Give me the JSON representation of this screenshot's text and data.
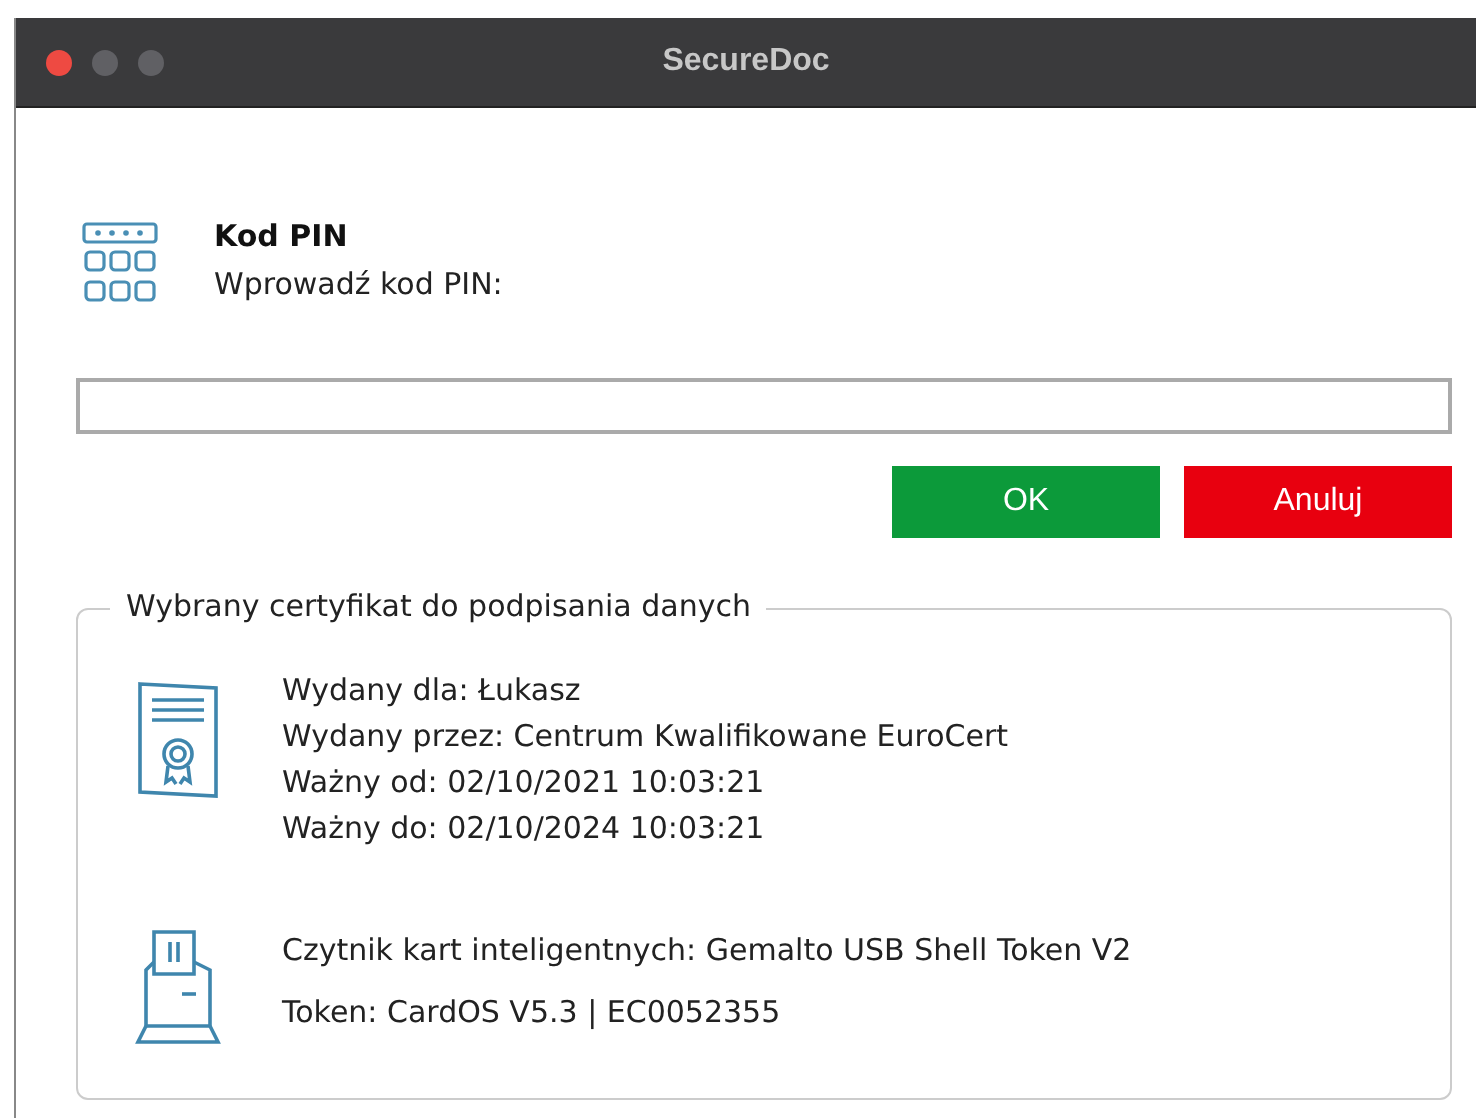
{
  "window": {
    "title": "SecureDoc"
  },
  "header": {
    "title": "Kod PIN",
    "subtitle": "Wprowadź kod PIN:"
  },
  "buttons": [
    {
      "label": "OK",
      "kind": "confirm"
    },
    {
      "label": "Anuluj",
      "kind": "cancel"
    }
  ],
  "certificate_group": {
    "legend": "Wybrany certyfikat do podpisania danych",
    "sections": [
      {
        "kind": "certificate",
        "lines": [
          "Wydany dla: Łukasz",
          "Wydany przez: Centrum Kwalifikowane EuroCert",
          "Ważny od: 02/10/2021 10:03:21",
          "Ważny do: 02/10/2024 10:03:21"
        ]
      },
      {
        "kind": "reader",
        "lines": [
          "Czytnik kart inteligentnych: Gemalto USB Shell Token V2",
          "Token: CardOS V5.3 | EC0052355"
        ]
      }
    ]
  }
}
